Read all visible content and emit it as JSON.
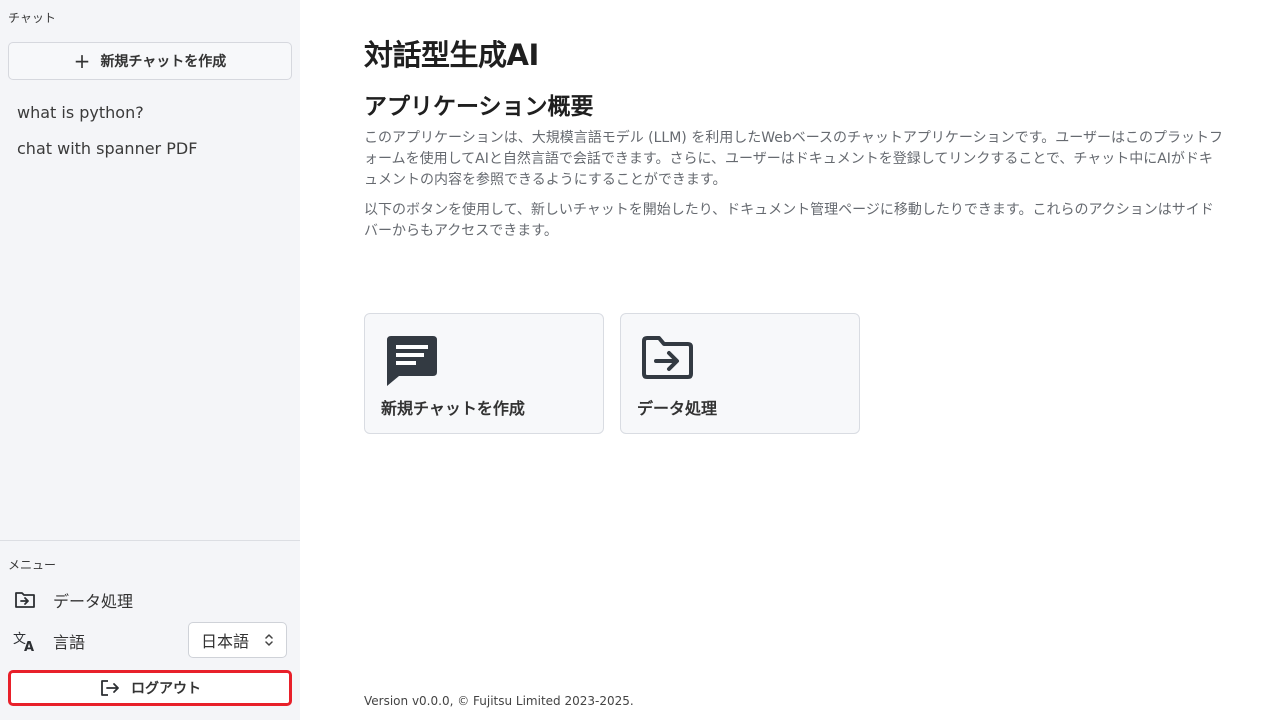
{
  "sidebar": {
    "chat_section_label": "チャット",
    "new_chat_label": "新規チャットを作成",
    "chats": [
      "what is python?",
      "chat with spanner PDF"
    ],
    "menu_section_label": "メニュー",
    "data_processing_label": "データ処理",
    "language_label": "言語",
    "language_selected": "日本語",
    "logout_label": "ログアウト"
  },
  "main": {
    "title": "対話型生成AI",
    "overview_title": "アプリケーション概要",
    "paragraph1": "このアプリケーションは、大規模言語モデル (LLM) を利用したWebベースのチャットアプリケーションです。ユーザーはこのプラットフォームを使用してAIと自然言語で会話できます。さらに、ユーザーはドキュメントを登録してリンクすることで、チャット中にAIがドキュメントの内容を参照できるようにすることができます。",
    "paragraph2": "以下のボタンを使用して、新しいチャットを開始したり、ドキュメント管理ページに移動したりできます。これらのアクションはサイドバーからもアクセスできます。",
    "cards": [
      {
        "label": "新規チャットを作成",
        "icon": "chat-icon"
      },
      {
        "label": "データ処理",
        "icon": "folder-arrow-icon"
      }
    ],
    "footer": "Version v0.0.0, © Fujitsu Limited 2023-2025."
  },
  "colors": {
    "sidebar_bg": "#f4f5f8",
    "logout_border": "#e8202a",
    "icon_dark": "#333a42"
  }
}
